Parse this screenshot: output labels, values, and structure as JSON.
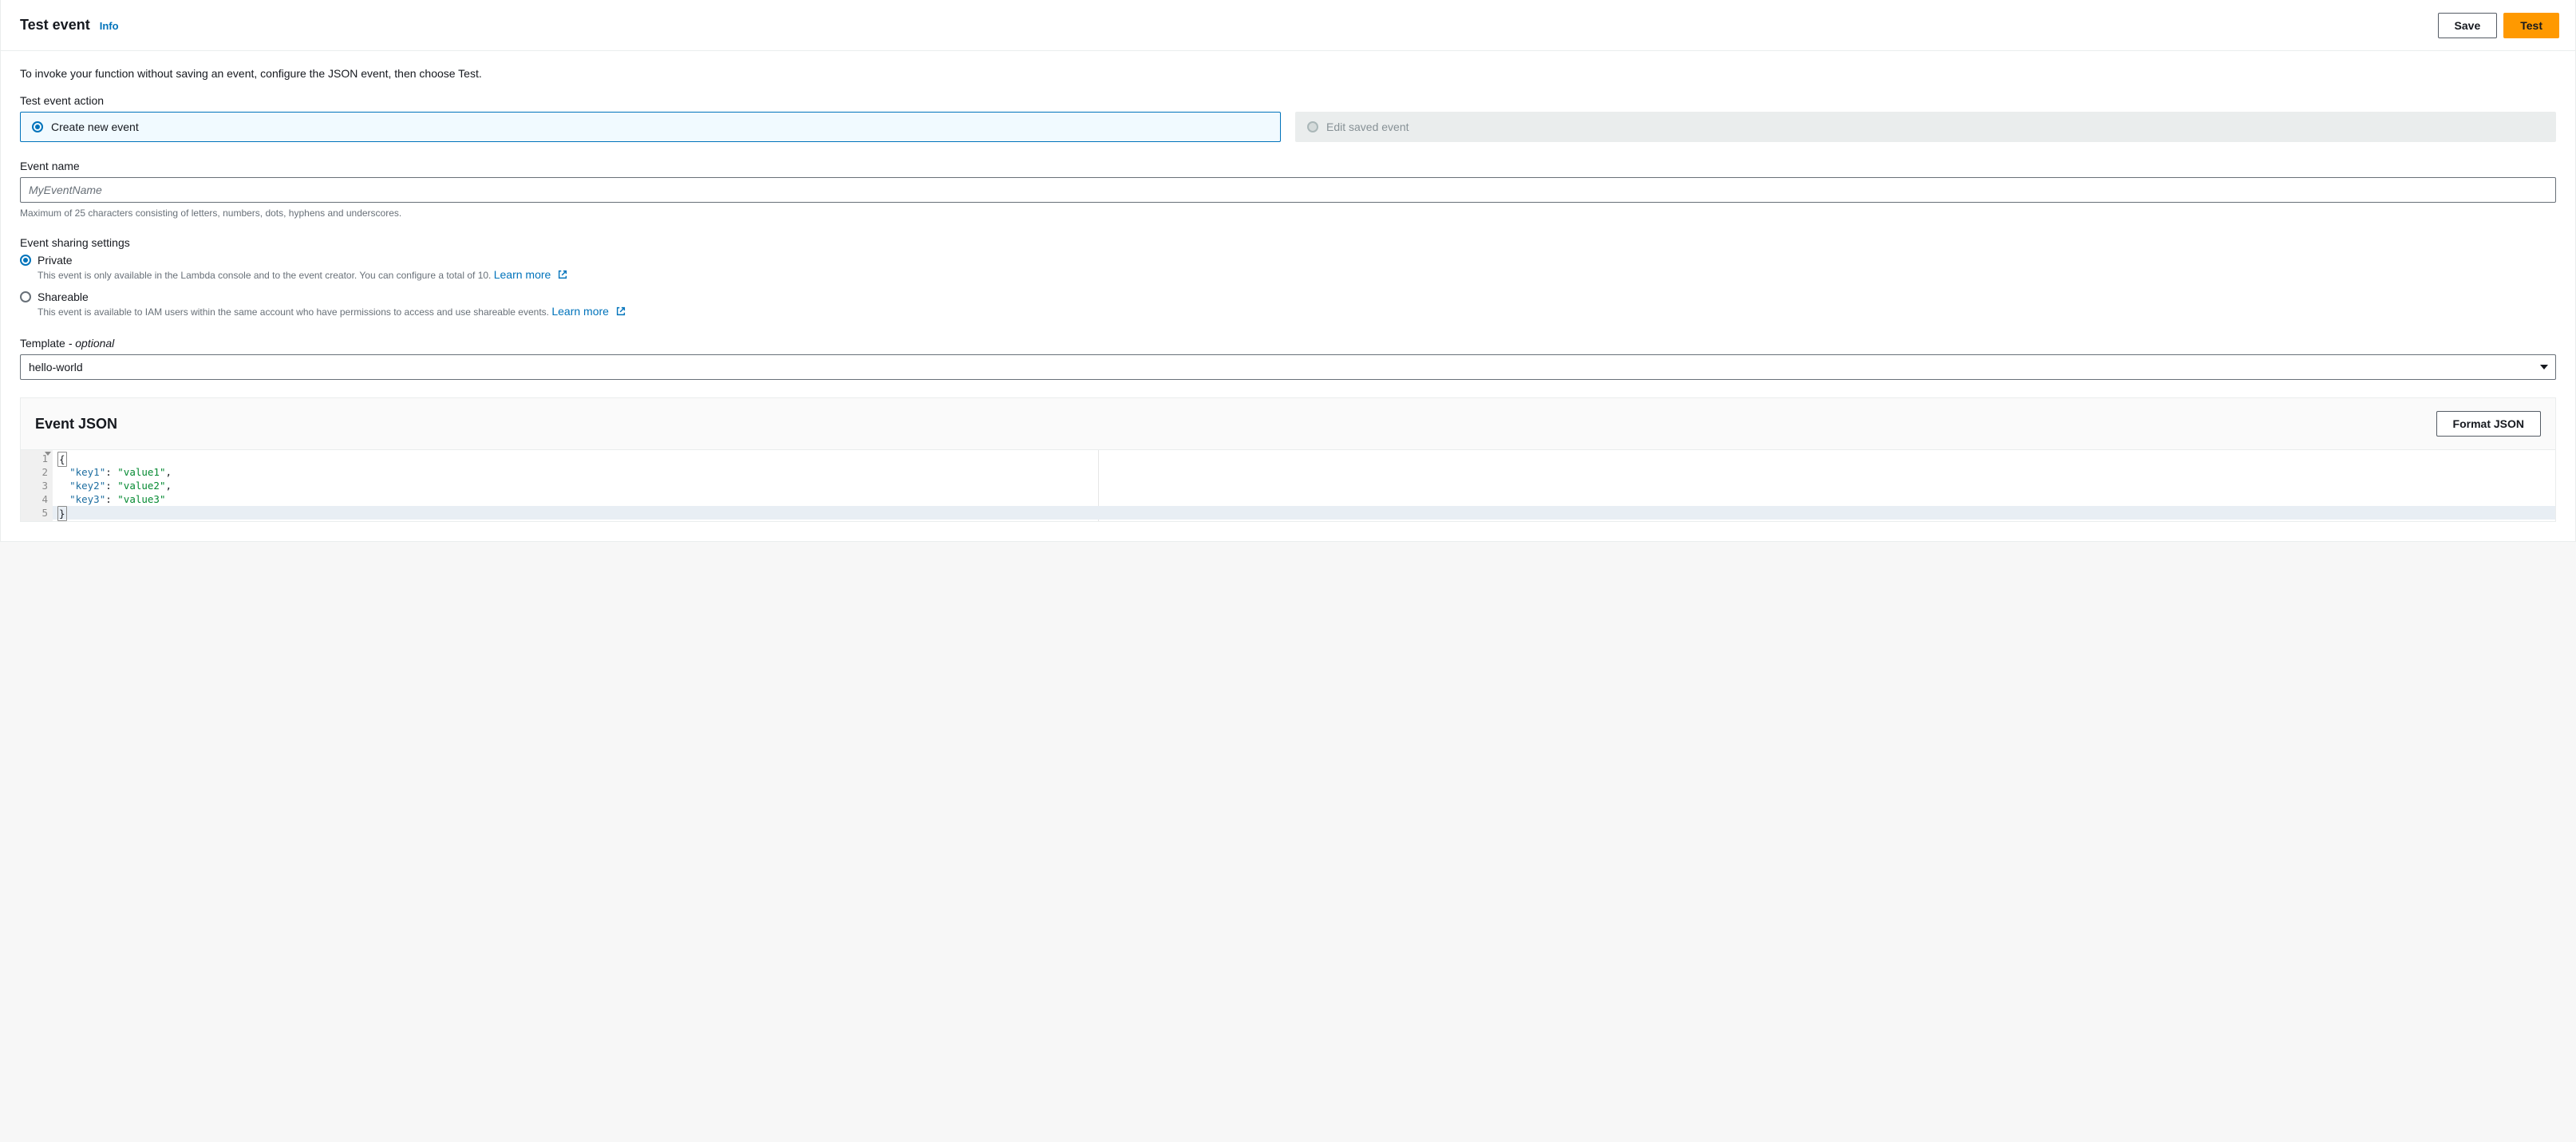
{
  "header": {
    "title": "Test event",
    "info": "Info",
    "save": "Save",
    "test": "Test"
  },
  "intro": "To invoke your function without saving an event, configure the JSON event, then choose Test.",
  "action": {
    "label": "Test event action",
    "create": "Create new event",
    "edit": "Edit saved event"
  },
  "eventName": {
    "label": "Event name",
    "placeholder": "MyEventName",
    "hint": "Maximum of 25 characters consisting of letters, numbers, dots, hyphens and underscores."
  },
  "sharing": {
    "label": "Event sharing settings",
    "private": {
      "label": "Private",
      "desc": "This event is only available in the Lambda console and to the event creator. You can configure a total of 10. ",
      "learn": "Learn more"
    },
    "shareable": {
      "label": "Shareable",
      "desc": "This event is available to IAM users within the same account who have permissions to access and use shareable events. ",
      "learn": "Learn more"
    }
  },
  "template": {
    "label": "Template",
    "optional": " - optional",
    "value": "hello-world"
  },
  "json": {
    "title": "Event JSON",
    "format": "Format JSON",
    "gutter": [
      "1",
      "2",
      "3",
      "4",
      "5"
    ],
    "code": {
      "l1_brace": "{",
      "l2_k": "\"key1\"",
      "l2_c": ": ",
      "l2_v": "\"value1\"",
      "l2_e": ",",
      "l3_k": "\"key2\"",
      "l3_c": ": ",
      "l3_v": "\"value2\"",
      "l3_e": ",",
      "l4_k": "\"key3\"",
      "l4_c": ": ",
      "l4_v": "\"value3\"",
      "l5_brace": "}"
    }
  }
}
